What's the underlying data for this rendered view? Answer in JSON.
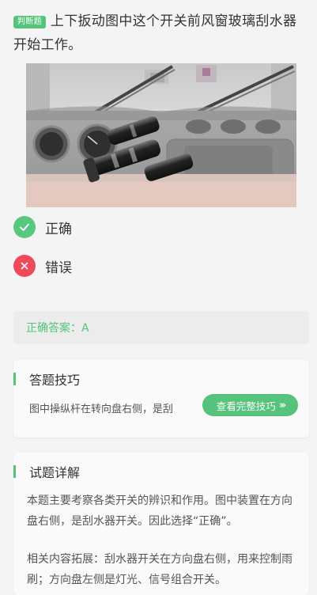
{
  "question": {
    "badge": "判断题",
    "text": "上下扳动图中这个开关前风窗玻璃刮水器开始工作。"
  },
  "options": [
    {
      "label": "正确",
      "icon": "check-icon"
    },
    {
      "label": "错误",
      "icon": "cross-icon"
    }
  ],
  "answer": {
    "text": "正确答案：A"
  },
  "tips": {
    "title": "答题技巧",
    "preview": "图中操纵杆在转向盘右侧，是刮",
    "button_label": "查看完整技巧"
  },
  "detail": {
    "title": "试题详解",
    "paragraph1": "本题主要考察各类开关的辨识和作用。图中装置在方向盘右侧，是刮水器开关。因此选择“正确”。",
    "paragraph2": "相关内容拓展：刮水器开关在方向盘右侧，用来控制雨刷；方向盘左侧是灯光、信号组合开关。"
  },
  "colors": {
    "accent": "#55c37a",
    "wrong": "#ee4a5c",
    "background": "#f4f4f4"
  }
}
